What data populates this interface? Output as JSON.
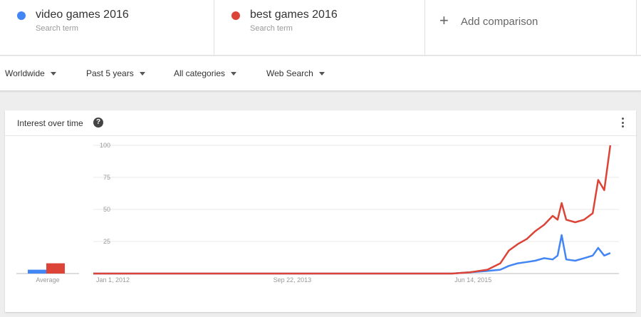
{
  "terms": [
    {
      "title": "video games 2016",
      "subtitle": "Search term",
      "color": "#4285f4"
    },
    {
      "title": "best games 2016",
      "subtitle": "Search term",
      "color": "#db4437"
    }
  ],
  "add_comparison": {
    "label": "Add comparison"
  },
  "filters": {
    "region": "Worldwide",
    "time": "Past 5 years",
    "category": "All categories",
    "search_type": "Web Search"
  },
  "card": {
    "title": "Interest over time",
    "help_icon": "help-icon",
    "more_icon": "more-vert-icon"
  },
  "chart_data": {
    "type": "line",
    "title": "Interest over time",
    "xlabel": "",
    "ylabel": "",
    "ylim": [
      0,
      100
    ],
    "yticks": [
      25,
      50,
      75,
      100
    ],
    "xticks": [
      "Jan 1, 2012",
      "Sep 22, 2013",
      "Jun 14, 2015"
    ],
    "xrange": [
      "2012-01",
      "2016-12"
    ],
    "grid": true,
    "average_label": "Average",
    "averages": [
      {
        "name": "video games 2016",
        "value": 3
      },
      {
        "name": "best games 2016",
        "value": 8
      }
    ],
    "series": [
      {
        "name": "video games 2016",
        "color": "#4285f4",
        "points": [
          [
            "2012-01-01",
            0
          ],
          [
            "2015-06-01",
            0
          ],
          [
            "2015-08-01",
            1
          ],
          [
            "2015-10-01",
            2
          ],
          [
            "2015-11-15",
            3
          ],
          [
            "2015-12-15",
            6
          ],
          [
            "2016-01-15",
            8
          ],
          [
            "2016-02-15",
            9
          ],
          [
            "2016-03-15",
            10
          ],
          [
            "2016-04-15",
            12
          ],
          [
            "2016-05-15",
            11
          ],
          [
            "2016-06-01",
            14
          ],
          [
            "2016-06-15",
            30
          ],
          [
            "2016-07-01",
            11
          ],
          [
            "2016-08-01",
            10
          ],
          [
            "2016-09-01",
            12
          ],
          [
            "2016-10-01",
            14
          ],
          [
            "2016-10-20",
            20
          ],
          [
            "2016-11-10",
            14
          ],
          [
            "2016-12-01",
            16
          ]
        ]
      },
      {
        "name": "best games 2016",
        "color": "#db4437",
        "points": [
          [
            "2012-01-01",
            0
          ],
          [
            "2015-06-01",
            0
          ],
          [
            "2015-08-01",
            1
          ],
          [
            "2015-10-01",
            3
          ],
          [
            "2015-11-15",
            8
          ],
          [
            "2015-12-15",
            18
          ],
          [
            "2016-01-15",
            23
          ],
          [
            "2016-02-15",
            27
          ],
          [
            "2016-03-15",
            33
          ],
          [
            "2016-04-15",
            38
          ],
          [
            "2016-05-15",
            45
          ],
          [
            "2016-06-01",
            42
          ],
          [
            "2016-06-15",
            55
          ],
          [
            "2016-07-01",
            42
          ],
          [
            "2016-08-01",
            40
          ],
          [
            "2016-09-01",
            42
          ],
          [
            "2016-10-01",
            47
          ],
          [
            "2016-10-20",
            73
          ],
          [
            "2016-11-10",
            65
          ],
          [
            "2016-12-01",
            100
          ]
        ]
      }
    ]
  }
}
